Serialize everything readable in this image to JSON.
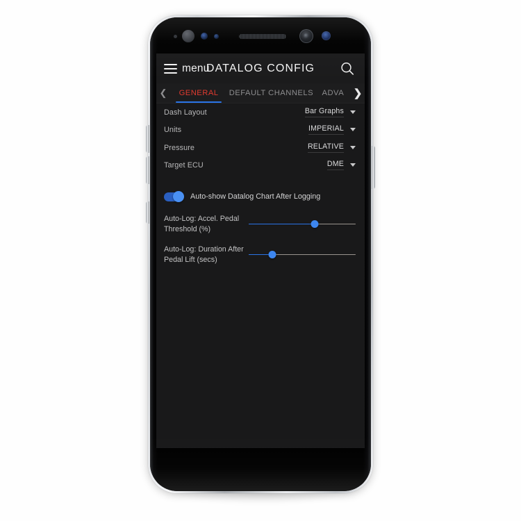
{
  "app": {
    "title": "DATALOG CONFIG",
    "menu_label": "menu",
    "menu_icon": "hamburger-icon",
    "search_icon": "search-icon"
  },
  "tabs": {
    "prev_icon": "chevron-left-icon",
    "next_icon": "chevron-right-icon",
    "items": [
      {
        "label": "GENERAL",
        "active": true
      },
      {
        "label": "DEFAULT CHANNELS",
        "active": false
      },
      {
        "label": "ADVA",
        "active": false
      }
    ]
  },
  "settings": {
    "rows": [
      {
        "label": "Dash Layout",
        "value": "Bar Graphs",
        "control": "dropdown"
      },
      {
        "label": "Units",
        "value": "IMPERIAL",
        "control": "dropdown"
      },
      {
        "label": "Pressure",
        "value": "RELATIVE",
        "control": "dropdown"
      },
      {
        "label": "Target ECU",
        "value": "DME",
        "control": "dropdown"
      }
    ]
  },
  "toggle": {
    "label": "Auto-show Datalog Chart After Logging",
    "state": "on"
  },
  "sliders": [
    {
      "label": "Auto-Log: Accel. Pedal Threshold (%)",
      "percent": 62
    },
    {
      "label": "Auto-Log: Duration After Pedal Lift (secs)",
      "percent": 22
    }
  ],
  "colors": {
    "accent_red": "#e03a2f",
    "accent_blue": "#2a74e8",
    "screen_bg": "#19191a",
    "appbar_bg": "#1b1b1c",
    "text_primary": "#f2f2f2",
    "text_secondary": "#b9b9ba"
  },
  "device": {
    "hardware_buttons": [
      "volume-up-button",
      "volume-down-button",
      "bixby-button",
      "power-button"
    ],
    "sensors": [
      "proximity-sensor",
      "earpiece-speaker",
      "iris-scanner",
      "front-camera",
      "flood-illuminator"
    ]
  }
}
